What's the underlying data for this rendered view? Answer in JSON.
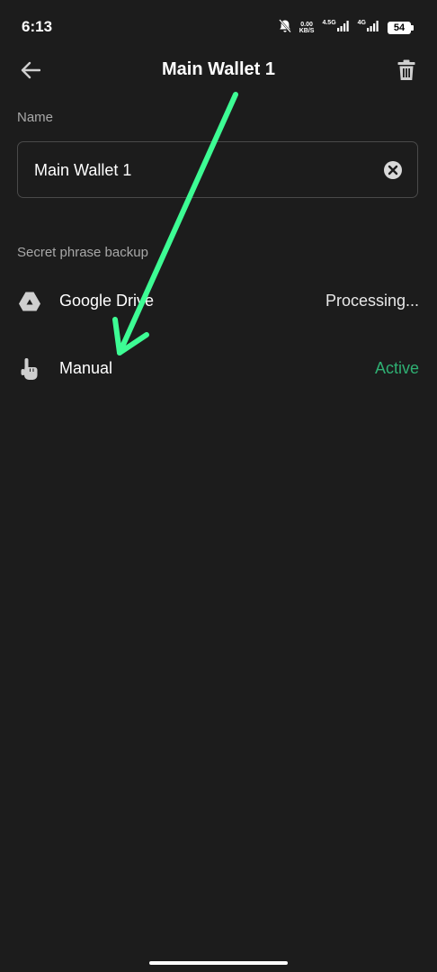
{
  "status_bar": {
    "time": "6:13",
    "data_speed_value": "0.00",
    "data_speed_unit": "KB/S",
    "network_1": "4.5G",
    "network_2": "4G",
    "battery": "54",
    "icons": [
      "mute-bell-icon",
      "signal-icon",
      "battery-icon"
    ]
  },
  "header": {
    "title": "Main Wallet 1",
    "back_icon": "arrow-left-icon",
    "delete_icon": "trash-icon"
  },
  "name_section": {
    "label": "Name",
    "value": "Main Wallet 1",
    "clear_icon": "clear-circle-icon"
  },
  "backup_section": {
    "label": "Secret phrase backup",
    "items": [
      {
        "label": "Google Drive",
        "status": "Processing...",
        "icon": "google-drive-icon",
        "status_color": "#e8e8e8"
      },
      {
        "label": "Manual",
        "status": "Active",
        "icon": "hand-pointer-icon",
        "status_color": "#2fb073"
      }
    ]
  },
  "colors": {
    "background": "#1c1c1c",
    "active_green": "#2fb073",
    "annotation_arrow": "#3dfc94"
  }
}
